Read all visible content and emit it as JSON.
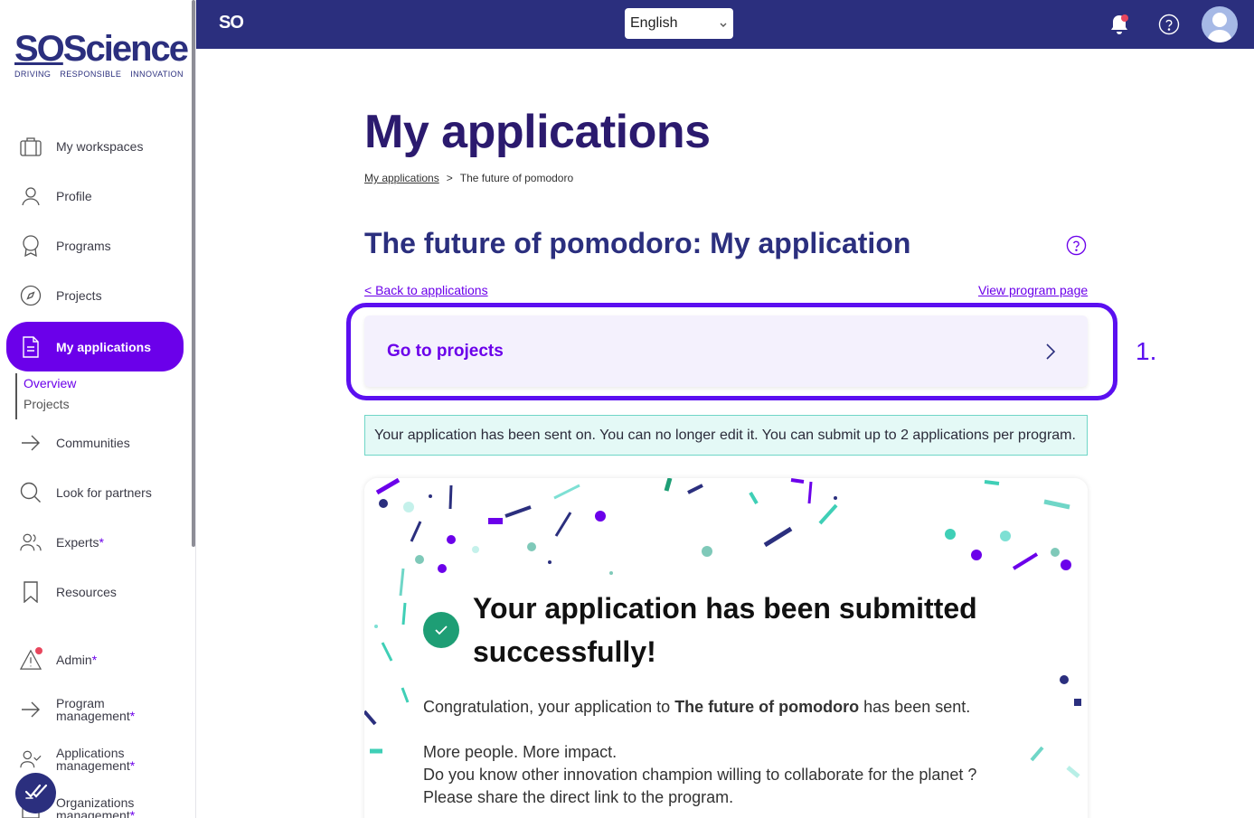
{
  "brand": {
    "logo_text_so": "SO",
    "logo_text_science": "Science",
    "tagline": [
      "DRIVING",
      "RESPONSIBLE",
      "INNOVATION"
    ],
    "topbar_logo": "SO"
  },
  "colors": {
    "primary": "#6b00ea",
    "navy": "#2b2f7e",
    "title_purple": "#2b1a6e",
    "success_green": "#1e9e75",
    "notice_bg": "#e4f9f6",
    "highlight": "#5b0ff0"
  },
  "sidebar": {
    "items": [
      {
        "label": "My workspaces",
        "icon": "briefcase-icon"
      },
      {
        "label": "Profile",
        "icon": "user-icon"
      },
      {
        "label": "Programs",
        "icon": "award-icon"
      },
      {
        "label": "Projects",
        "icon": "compass-icon"
      },
      {
        "label": "My applications",
        "icon": "document-icon",
        "active": true
      },
      {
        "label": "Communities",
        "icon": "arrow-right-icon"
      },
      {
        "label": "Look for partners",
        "icon": "search-icon"
      },
      {
        "label": "Experts",
        "star": "*",
        "icon": "users-icon"
      },
      {
        "label": "Resources",
        "icon": "bookmark-icon"
      },
      {
        "label": "Admin",
        "star": "*",
        "icon": "warning-icon"
      },
      {
        "label_line1": "Program",
        "label_line2": "management",
        "star": "*",
        "icon": "arrow-right-icon"
      },
      {
        "label_line1": "Applications",
        "label_line2": "management",
        "star": "*",
        "icon": "user-check-icon"
      },
      {
        "label_line1": "Organizations",
        "label_line2": "management",
        "star": "*",
        "icon": "building-icon"
      }
    ],
    "subnav": [
      "Overview",
      "Projects"
    ]
  },
  "topbar": {
    "language": "English"
  },
  "page": {
    "title": "My applications",
    "breadcrumb_root": "My applications",
    "breadcrumb_sep": ">",
    "breadcrumb_current": "The future of pomodoro",
    "app_title": "The future of pomodoro: My application",
    "back_link": "< Back to applications",
    "program_link": "View program page",
    "goto_projects": "Go to projects",
    "step_label": "1.",
    "notice": "Your application has been sent on. You can no longer edit it. You can submit up to 2 applications per program.",
    "success_title": "Your application has been submitted successfully!",
    "msg_prefix": "Congratulation, your application to ",
    "msg_program": "The future of pomodoro",
    "msg_suffix": " has been sent.",
    "msg_line2": "More people. More impact.",
    "msg_line3": "Do you know other innovation champion willing to collaborate for the planet ?",
    "msg_line4": "Please share the direct link to the program."
  }
}
